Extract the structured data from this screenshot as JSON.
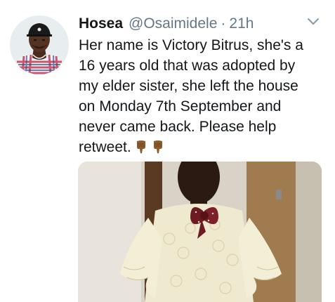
{
  "tweet": {
    "display_name": "Hosea",
    "handle": "@Osaimidele",
    "separator": "·",
    "timestamp": "21h",
    "text_lines": [
      "Her name is Victory Bitrus, she's a",
      "16 years old that was adopted by",
      "my elder sister, she left the house",
      "on Monday 7th September and",
      "never came back. Please help",
      "retweet."
    ],
    "emojis": [
      "backhand-index-pointing-down-icon",
      "backhand-index-pointing-down-icon"
    ],
    "media_alt": "photo"
  },
  "colors": {
    "text_primary": "#14171a",
    "text_secondary": "#657786",
    "background": "#ffffff"
  },
  "icons": {
    "menu": "chevron-down-icon"
  }
}
